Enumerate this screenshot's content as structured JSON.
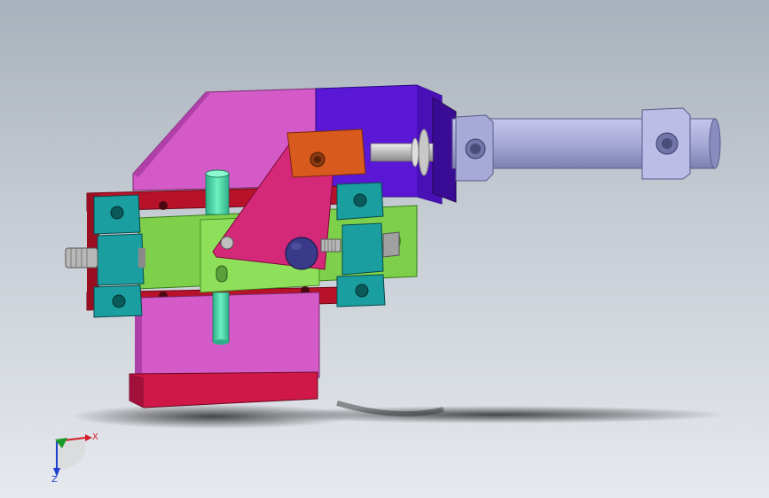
{
  "viewport": {
    "background_top": "#a9b1bc",
    "background_bottom": "#e6e9ee"
  },
  "triad": {
    "x_label": "X",
    "z_label": "Z",
    "x_color": "#d0202a",
    "y_color": "#1a9a2a",
    "z_color": "#1d3fd0"
  },
  "colors": {
    "magenta_plate": "#d45bc7",
    "purple_block": "#5a18d6",
    "cylinder_body": "#a7a9d6",
    "orange_clevis": "#d85a1c",
    "pink_lever": "#d42879",
    "green_slide": "#7ed04a",
    "dark_red_rail": "#b8122a",
    "teal_blocks": "#1a9ea0",
    "mint_pin": "#4ad8a6",
    "navy_roller": "#3a3a8a",
    "red_base": "#d01848"
  }
}
